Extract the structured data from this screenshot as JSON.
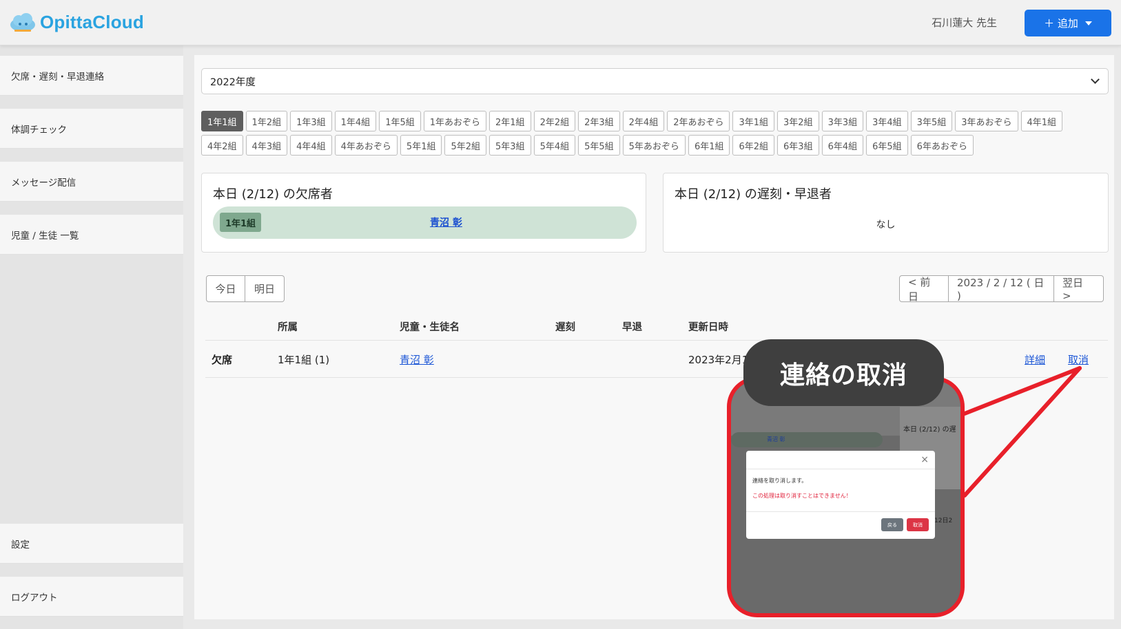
{
  "header": {
    "logo_text": "OpittaCloud",
    "user_name": "石川蓮大 先生",
    "add_button": "＋ 追加"
  },
  "sidebar": {
    "items": [
      {
        "label": "欠席・遅刻・早退連絡"
      },
      {
        "label": "体調チェック"
      },
      {
        "label": "メッセージ配信"
      },
      {
        "label": "児童 / 生徒 一覧"
      },
      {
        "label": "設定"
      },
      {
        "label": "ログアウト"
      }
    ]
  },
  "year_select": {
    "value": "2022年度"
  },
  "classes": {
    "row1": [
      "1年1組",
      "1年2組",
      "1年3組",
      "1年4組",
      "1年5組",
      "1年あおぞら",
      "2年1組",
      "2年2組",
      "2年3組",
      "2年4組",
      "2年あおぞら",
      "3年1組",
      "3年2組",
      "3年3組",
      "3年4組",
      "3年5組",
      "3年あおぞら",
      "4年1組"
    ],
    "row2": [
      "4年2組",
      "4年3組",
      "4年4組",
      "4年あおぞら",
      "5年1組",
      "5年2組",
      "5年3組",
      "5年4組",
      "5年5組",
      "5年あおぞら",
      "6年1組",
      "6年2組",
      "6年3組",
      "6年4組",
      "6年5組",
      "6年あおぞら"
    ],
    "selected": "1年1組"
  },
  "absent_card": {
    "title": "本日 (2/12) の欠席者",
    "class_badge": "1年1組",
    "student": "青沼 彰"
  },
  "late_card": {
    "title": "本日 (2/12) の遅刻・早退者",
    "empty_text": "なし"
  },
  "day_buttons": {
    "today": "今日",
    "tomorrow": "明日"
  },
  "date_nav": {
    "prev": "< 前日",
    "date": "2023 / 2 / 12 ( 日 )",
    "next": "翌日 >"
  },
  "table": {
    "headers": {
      "affiliation": "所属",
      "student": "児童・生徒名",
      "late": "遅刻",
      "early": "早退",
      "updated": "更新日時"
    },
    "row": {
      "type": "欠席",
      "affiliation": "1年1組 (1)",
      "student": "青沼 彰",
      "updated": "2023年2月1",
      "detail": "詳細",
      "cancel": "取消"
    }
  },
  "callout": {
    "text": "連絡の取消"
  },
  "inset": {
    "card_title": "本日 (2/12) の遅",
    "student": "青沼 彰",
    "row_fragment": "月12日2",
    "modal_message": "連絡を取り消します。",
    "modal_warning": "この処理は取り消すことはできません！",
    "back_button": "戻る",
    "cancel_button": "取消",
    "close_glyph": "×"
  },
  "colors": {
    "accent": "#1a73e8",
    "highlight": "#e8202a",
    "callout": "#3f3f3f",
    "absent_bar": "#cfe3d6",
    "active_class": "#5f5f5f"
  }
}
